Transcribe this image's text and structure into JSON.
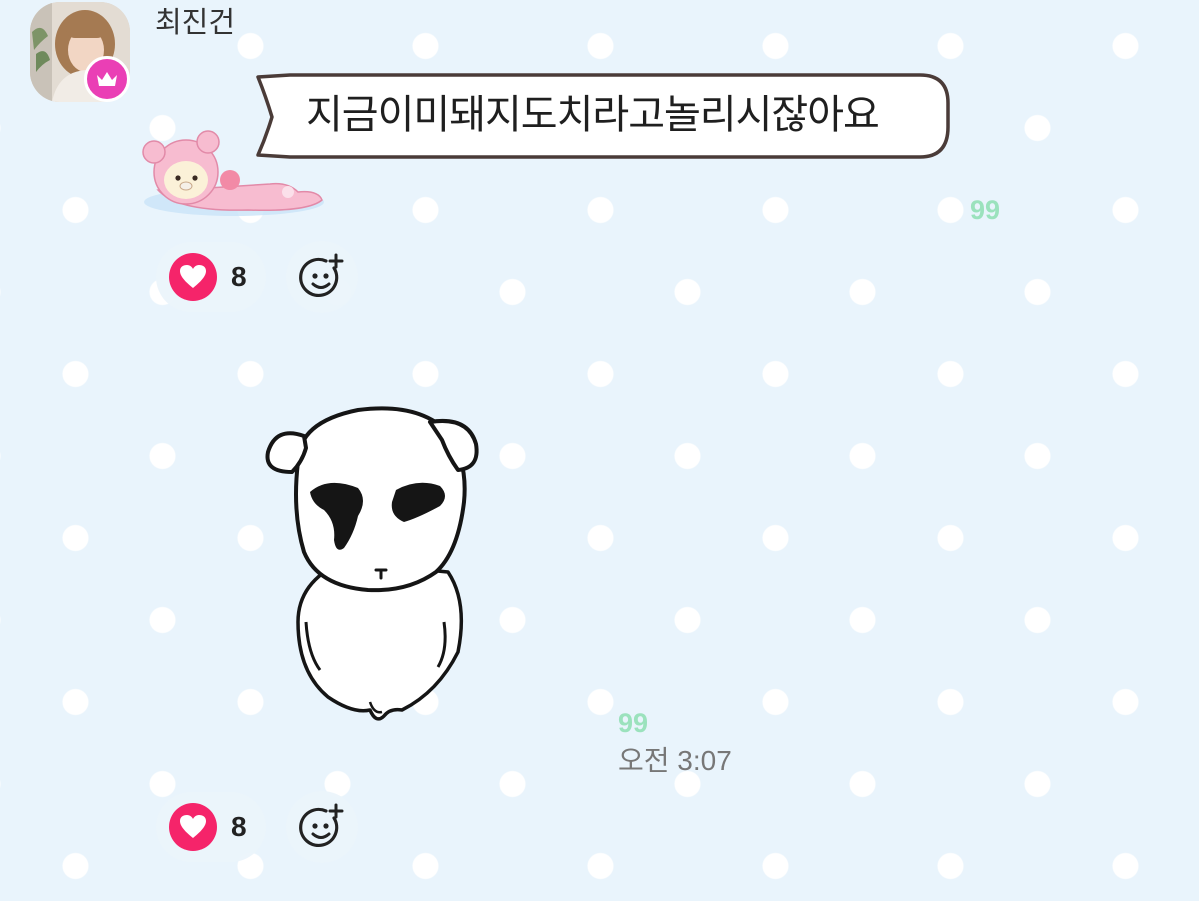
{
  "message_group": {
    "sender": {
      "name": "최진건"
    },
    "messages": [
      {
        "type": "text",
        "text": "지금이미돼지도치라고놀리시잖아요",
        "read_count": "99",
        "reactions": {
          "likes": "8"
        }
      },
      {
        "type": "sticker",
        "sticker": "dog-sticker",
        "read_count": "99",
        "time": "오전 3:07",
        "reactions": {
          "likes": "8"
        }
      }
    ]
  },
  "colors": {
    "background": "#e9f4fc",
    "crown_badge": "#ea3fb5",
    "heart": "#f5246a",
    "read_count": "#9be2bd"
  },
  "icons": [
    "crown-icon",
    "heart-icon",
    "add-emoji-icon",
    "bear-sticker",
    "dog-sticker"
  ]
}
